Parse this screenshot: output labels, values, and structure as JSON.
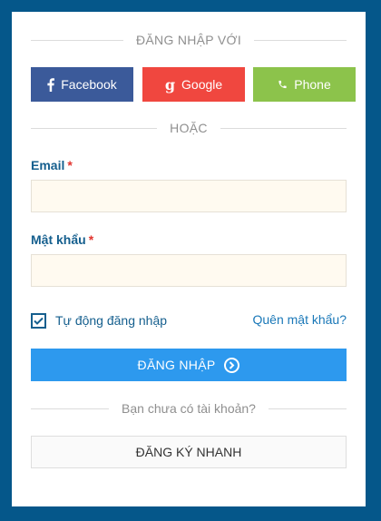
{
  "login_with": {
    "heading": "ĐĂNG NHẬP VỚI"
  },
  "social": {
    "facebook": {
      "label": "Facebook",
      "icon": "facebook-icon",
      "color": "#3b5a9a"
    },
    "google": {
      "label": "Google",
      "icon": "google-icon",
      "color": "#f0473f"
    },
    "phone": {
      "label": "Phone",
      "icon": "phone-icon",
      "color": "#8cc34b"
    }
  },
  "or_divider": "HOẶC",
  "form": {
    "email": {
      "label": "Email",
      "required_mark": "*",
      "value": "",
      "placeholder": ""
    },
    "password": {
      "label": "Mật khẩu",
      "required_mark": "*",
      "value": "",
      "placeholder": ""
    },
    "remember": {
      "label": "Tự động đăng nhập",
      "checked": true
    },
    "forgot_link": "Quên mật khẩu?",
    "login_button": {
      "label": "ĐĂNG NHẬP",
      "icon": "chevron-right-circle-icon",
      "color": "#2d99ee"
    }
  },
  "signup": {
    "prompt": "Bạn chưa có tài khoản?",
    "button_label": "ĐĂNG KÝ NHANH"
  },
  "colors": {
    "background": "#05578a",
    "label": "#155f8e",
    "required": "#e2342e",
    "input_bg": "#fffaf0"
  }
}
